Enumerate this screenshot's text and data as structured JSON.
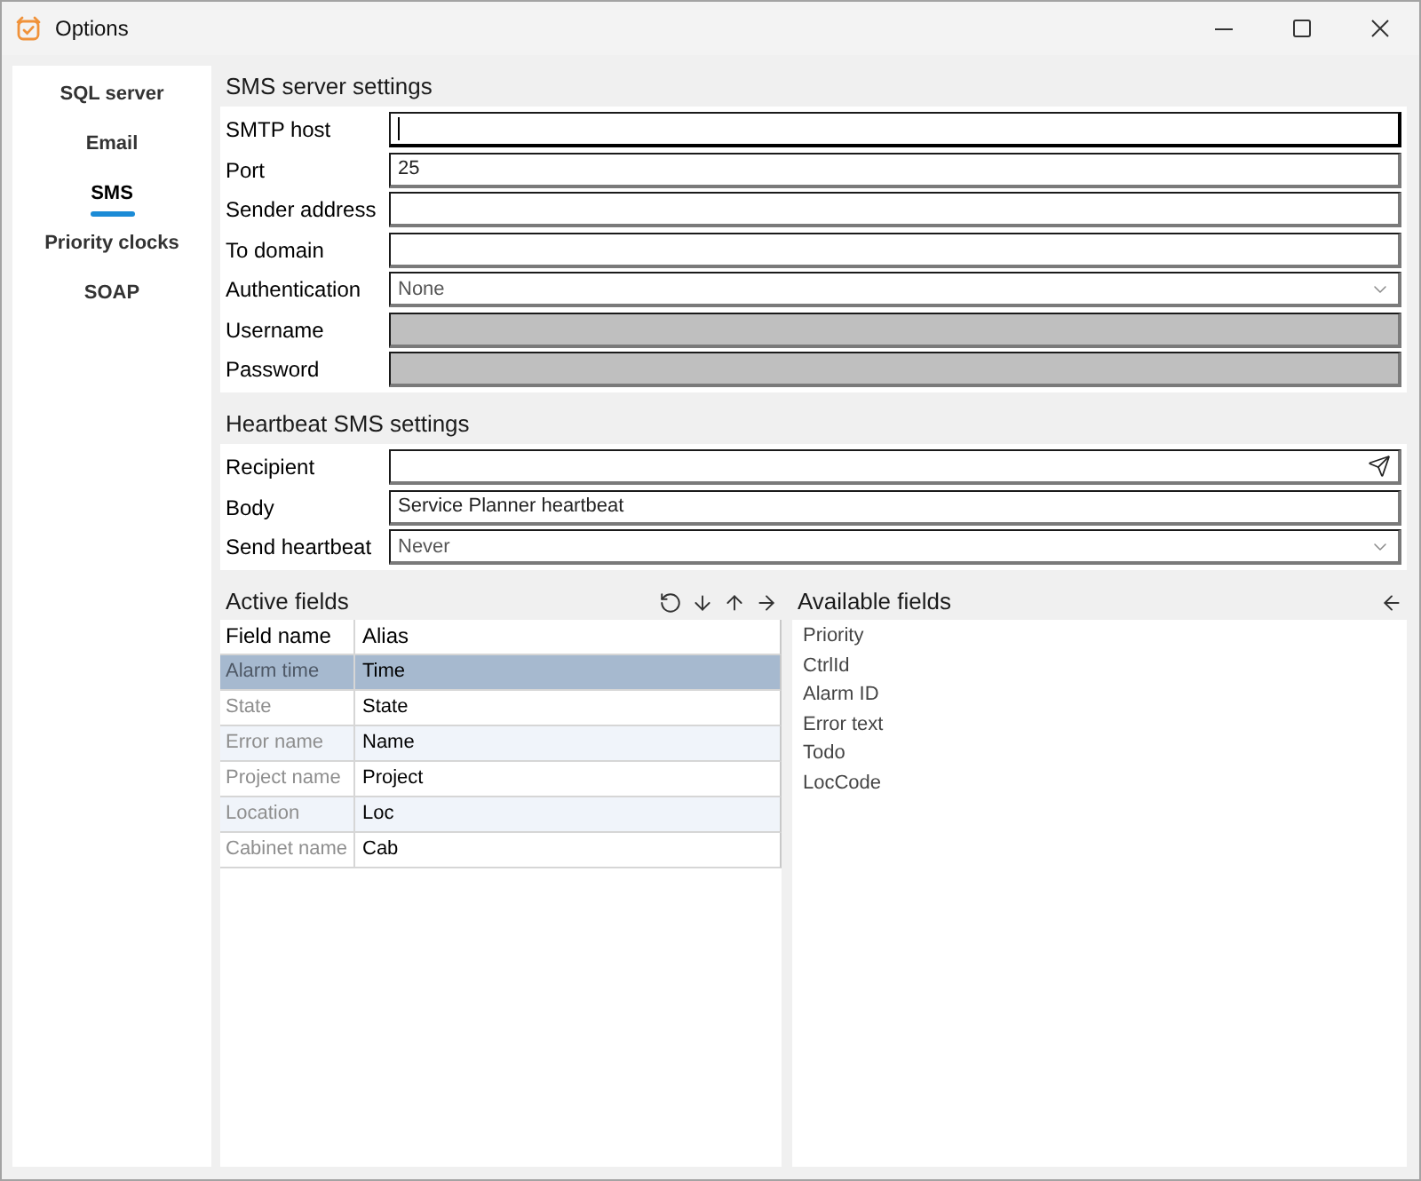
{
  "window": {
    "title": "Options"
  },
  "sidebar": {
    "items": [
      {
        "label": "SQL server",
        "selected": false
      },
      {
        "label": "Email",
        "selected": false
      },
      {
        "label": "SMS",
        "selected": true
      },
      {
        "label": "Priority clocks",
        "selected": false
      },
      {
        "label": "SOAP",
        "selected": false
      }
    ]
  },
  "sms_server_settings": {
    "title": "SMS server settings",
    "fields": [
      {
        "label": "SMTP host",
        "kind": "text",
        "focused": true,
        "disabled": false
      },
      {
        "label": "Port",
        "kind": "text",
        "value": "25",
        "focused": false,
        "disabled": false
      },
      {
        "label": "Sender address",
        "kind": "text",
        "focused": false,
        "disabled": false
      },
      {
        "label": "To domain",
        "kind": "text",
        "focused": false,
        "disabled": false
      },
      {
        "label": "Authentication",
        "kind": "select",
        "value": "None",
        "focused": false,
        "disabled": false
      },
      {
        "label": "Username",
        "kind": "text",
        "focused": false,
        "disabled": true
      },
      {
        "label": "Password",
        "kind": "text",
        "focused": false,
        "disabled": true
      }
    ]
  },
  "heartbeat_sms_settings": {
    "title": "Heartbeat SMS settings",
    "fields": [
      {
        "label": "Recipient",
        "kind": "send",
        "focused": false,
        "disabled": false
      },
      {
        "label": "Body",
        "kind": "text",
        "value": "Service Planner heartbeat",
        "focused": false,
        "disabled": false
      },
      {
        "label": "Send heartbeat",
        "kind": "select",
        "value": "Never",
        "focused": false,
        "disabled": false
      }
    ]
  },
  "active_fields": {
    "title": "Active fields",
    "columns": [
      "Field name",
      "Alias"
    ],
    "rows": [
      {
        "field_name": "Alarm time",
        "alias": "Time",
        "selected": true
      },
      {
        "field_name": "State",
        "alias": "State",
        "selected": false
      },
      {
        "field_name": "Error name",
        "alias": "Name",
        "selected": false
      },
      {
        "field_name": "Project name",
        "alias": "Project",
        "selected": false
      },
      {
        "field_name": "Location",
        "alias": "Loc",
        "selected": false
      },
      {
        "field_name": "Cabinet name",
        "alias": "Cab",
        "selected": false
      }
    ]
  },
  "available_fields": {
    "title": "Available fields",
    "items": [
      {
        "label": "Priority",
        "selected": false
      },
      {
        "label": "CtrlId",
        "selected": false
      },
      {
        "label": "Alarm ID",
        "selected": false
      },
      {
        "label": "Error text",
        "selected": false
      },
      {
        "label": "Todo",
        "selected": false
      },
      {
        "label": "LocCode",
        "selected": false
      }
    ]
  }
}
